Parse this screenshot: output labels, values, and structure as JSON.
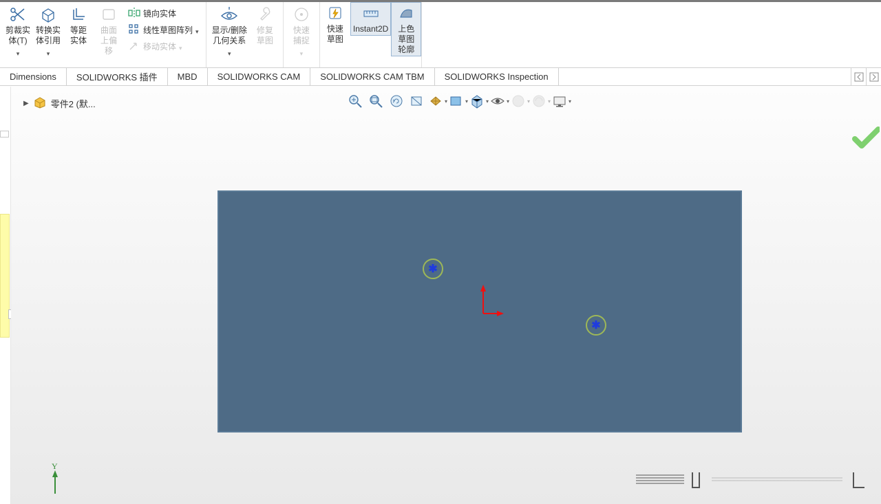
{
  "ribbon": {
    "trim_label": "剪裁实\n体(T)",
    "convert_label": "转换实\n体引用",
    "offset_label": "等距\n实体",
    "surface_offset_label": "曲面\n上偏\n移",
    "mirror_label": "镜向实体",
    "linear_pattern_label": "线性草图阵列",
    "move_label": "移动实体",
    "display_rel_label": "显示/删除\n几何关系",
    "repair_label": "修复\n草图",
    "quick_snap_label": "快速\n捕捉",
    "quick_sketch_label": "快速\n草图",
    "instant2d_label": "Instant2D",
    "shaded_contour_label": "上色\n草图\n轮廓"
  },
  "tabs": {
    "dimensions": "Dimensions",
    "addins": "SOLIDWORKS 插件",
    "mbd": "MBD",
    "cam": "SOLIDWORKS CAM",
    "cam_tbm": "SOLIDWORKS CAM TBM",
    "inspection": "SOLIDWORKS Inspection"
  },
  "breadcrumb": {
    "part_name": "零件2  (默..."
  },
  "triad": {
    "y_label": "Y"
  }
}
